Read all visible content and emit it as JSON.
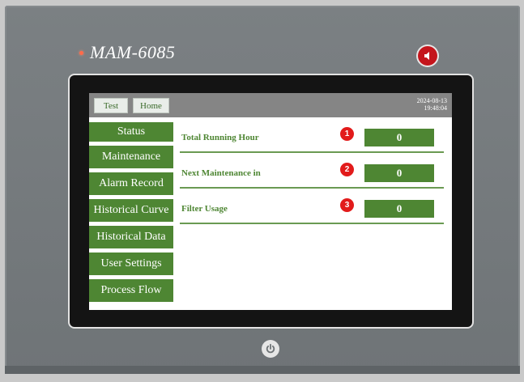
{
  "device": {
    "model": "MAM-6085",
    "speaker_icon": "speaker-icon",
    "power_icon": "power-icon",
    "accent": "#c4151c"
  },
  "topbar": {
    "test_label": "Test",
    "home_label": "Home",
    "date": "2024-08-13",
    "time": "19:48:04"
  },
  "sidebar": {
    "items": [
      {
        "label": "Status"
      },
      {
        "label": "Maintenance"
      },
      {
        "label": "Alarm Record"
      },
      {
        "label": "Historical Curve"
      },
      {
        "label": "Historical Data"
      },
      {
        "label": "User Settings"
      },
      {
        "label": "Process Flow"
      }
    ],
    "color": "#4e8633"
  },
  "status": {
    "rows": [
      {
        "label": "Total Running Hour",
        "badge": "1",
        "value": "0"
      },
      {
        "label": "Next Maintenance in",
        "badge": "2",
        "value": "0"
      },
      {
        "label": "Filter Usage",
        "badge": "3",
        "value": "0"
      }
    ]
  }
}
